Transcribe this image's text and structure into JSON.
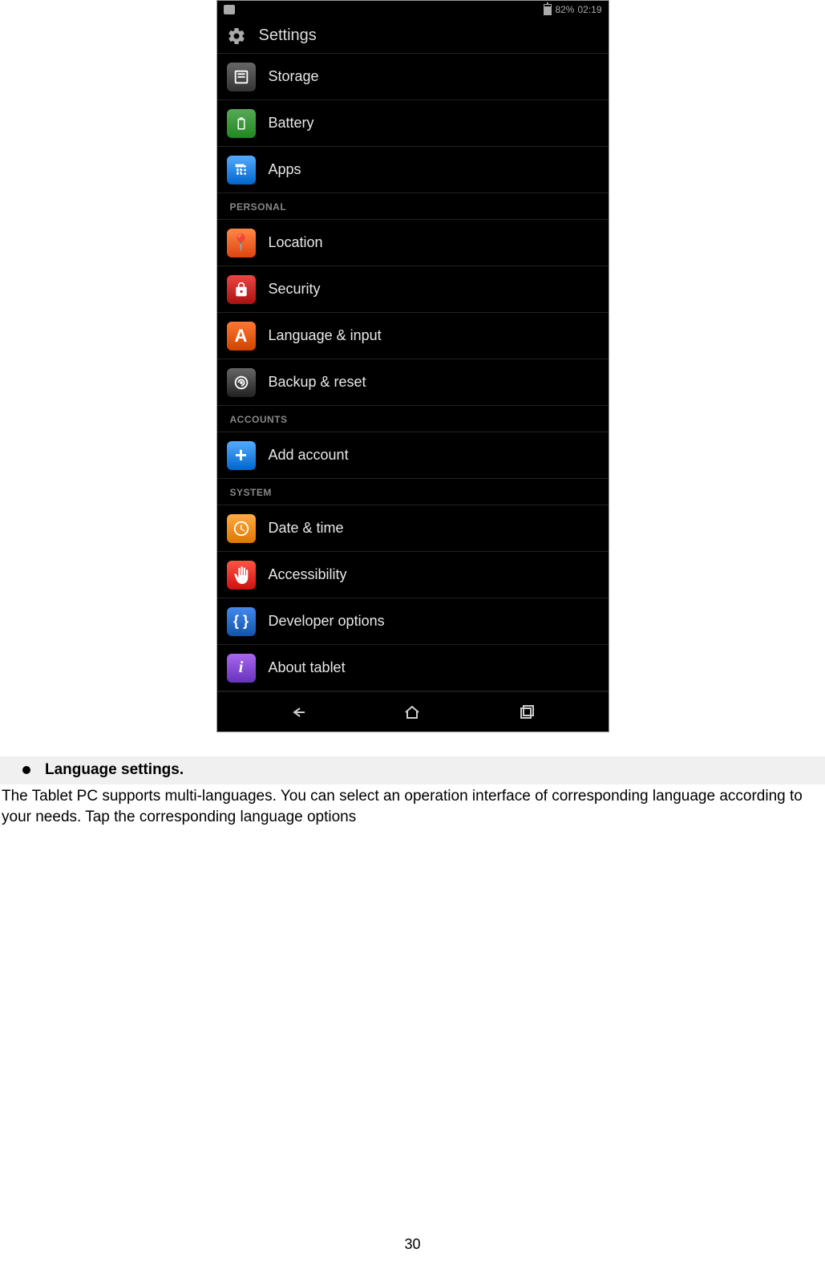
{
  "statusBar": {
    "battery_text": "82%",
    "time": "02:19"
  },
  "header": {
    "title": "Settings"
  },
  "sections": {
    "personal": "PERSONAL",
    "accounts": "ACCOUNTS",
    "system": "SYSTEM"
  },
  "items": {
    "storage": "Storage",
    "battery": "Battery",
    "apps": "Apps",
    "location": "Location",
    "security": "Security",
    "language": "Language & input",
    "backup": "Backup & reset",
    "add_account": "Add account",
    "date_time": "Date & time",
    "accessibility": "Accessibility",
    "developer": "Developer options",
    "about": "About tablet"
  },
  "doc": {
    "heading": "Language settings.",
    "body": "The Tablet PC supports multi-languages. You can select an operation interface of corresponding language according to your needs. Tap the corresponding language options",
    "page_number": "30"
  }
}
